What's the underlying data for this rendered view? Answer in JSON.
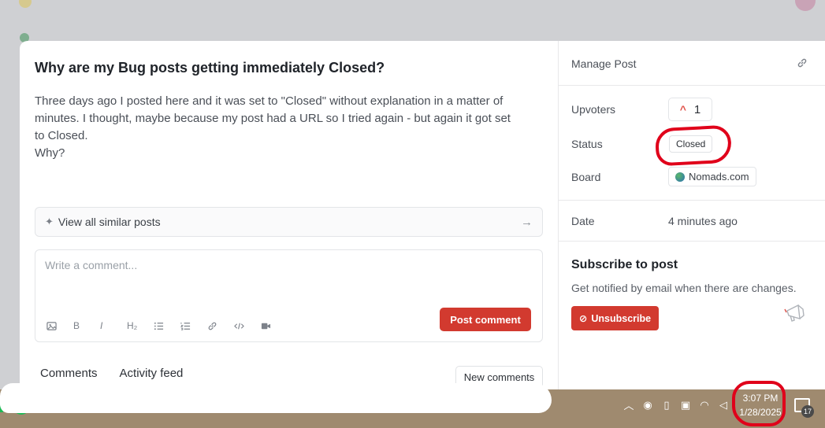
{
  "post": {
    "title": "Why are my Bug posts getting immediately Closed?",
    "body": "Three days ago I posted here and it was set to \"Closed\" without explanation in a matter of\nminutes. I thought, maybe because my post had a URL so I tried again - but again it got set\nto Closed.\nWhy?"
  },
  "similar": {
    "label": "View all similar posts"
  },
  "comment": {
    "placeholder": "Write a comment...",
    "submit_label": "Post comment",
    "toolbar": [
      "image-icon",
      "bold-icon",
      "italic-icon",
      "heading-icon",
      "bullet-list-icon",
      "numbered-list-icon",
      "link-icon",
      "code-icon",
      "video-icon"
    ]
  },
  "tabs": [
    "Comments",
    "Activity feed"
  ],
  "new_comments_label": "New comments",
  "panel": {
    "manage_label": "Manage Post",
    "upvoters_label": "Upvoters",
    "upvote_count": "1",
    "status_label": "Status",
    "status_value": "Closed",
    "board_label": "Board",
    "board_value": "Nomads.com",
    "date_label": "Date",
    "date_value": "4 minutes ago",
    "subscribe_title": "Subscribe to post",
    "subscribe_desc": "Get notified by email when there are changes.",
    "unsubscribe_label": "Unsubscribe"
  },
  "taskbar": {
    "time": "3:07 PM",
    "date": "1/28/2025",
    "notification_count": "17"
  },
  "colors": {
    "accent": "#d23a2f",
    "annotation": "#e0001a"
  }
}
